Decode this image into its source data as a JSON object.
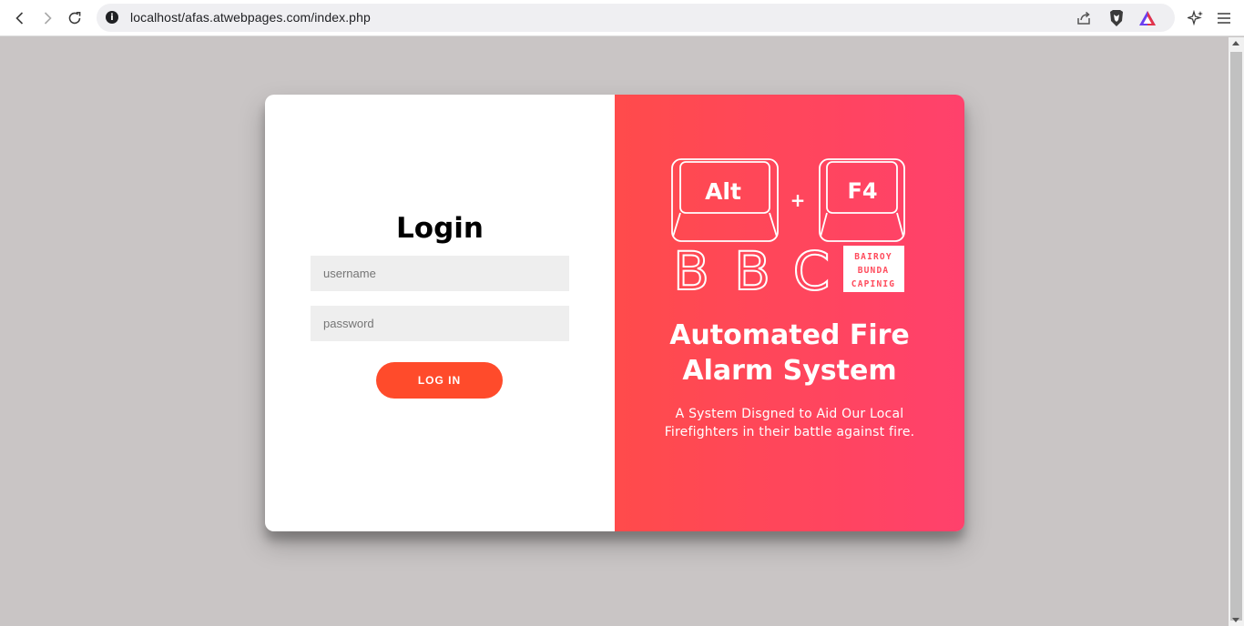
{
  "browser": {
    "url": "localhost/afas.atwebpages.com/index.php"
  },
  "login": {
    "title": "Login",
    "username_placeholder": "username",
    "password_placeholder": "password",
    "button_label": "LOG IN"
  },
  "logo": {
    "key1": "Alt",
    "plus": "+",
    "key2": "F4",
    "letters": [
      "B",
      "B",
      "C"
    ],
    "box_lines": [
      "BAIROY",
      "BUNDA",
      "CAPINIG"
    ]
  },
  "promo": {
    "headline_line1": "Automated Fire",
    "headline_line2": "Alarm System",
    "tagline_line1": "A System Disgned to Aid Our Local",
    "tagline_line2": "Firefighters in their battle against fire."
  },
  "colors": {
    "button": "#ff4b2b",
    "gradient_start": "#ff4b4b",
    "gradient_end": "#ff416c",
    "page_background": "#c9c5c5"
  },
  "icons": [
    "back-icon",
    "forward-icon",
    "reload-icon",
    "info-icon",
    "share-icon",
    "brave-shield-icon",
    "brave-rewards-icon",
    "leo-ai-icon",
    "menu-icon"
  ]
}
